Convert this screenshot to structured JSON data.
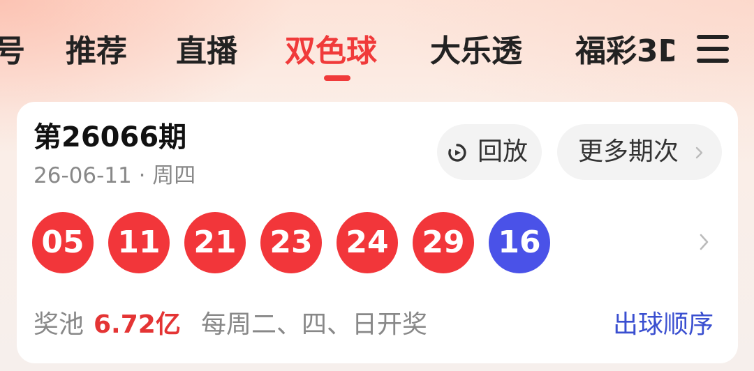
{
  "tabs": {
    "partial_left": "号",
    "items": [
      {
        "label": "推荐",
        "active": false
      },
      {
        "label": "直播",
        "active": false
      },
      {
        "label": "双色球",
        "active": true
      },
      {
        "label": "大乐透",
        "active": false
      }
    ],
    "partial_right": "福彩3D",
    "menu_icon": "hamburger-menu-icon"
  },
  "draw": {
    "issue_title": "第26066期",
    "date_line": "26-06-11 · 周四",
    "replay_label": "回放",
    "replay_icon": "replay-icon",
    "more_label": "更多期次",
    "more_icon": "chevron-right-icon",
    "red_balls": [
      "05",
      "11",
      "21",
      "23",
      "24",
      "29"
    ],
    "blue_ball": "16",
    "pool_label": "奖池",
    "pool_amount": "6.72亿",
    "schedule": "每周二、四、日开奖",
    "order_link": "出球顺序"
  },
  "colors": {
    "accent_red": "#f03a3a",
    "red_ball": "#f2363a",
    "blue_ball": "#4a52e8",
    "link_blue": "#3a4fd0"
  }
}
